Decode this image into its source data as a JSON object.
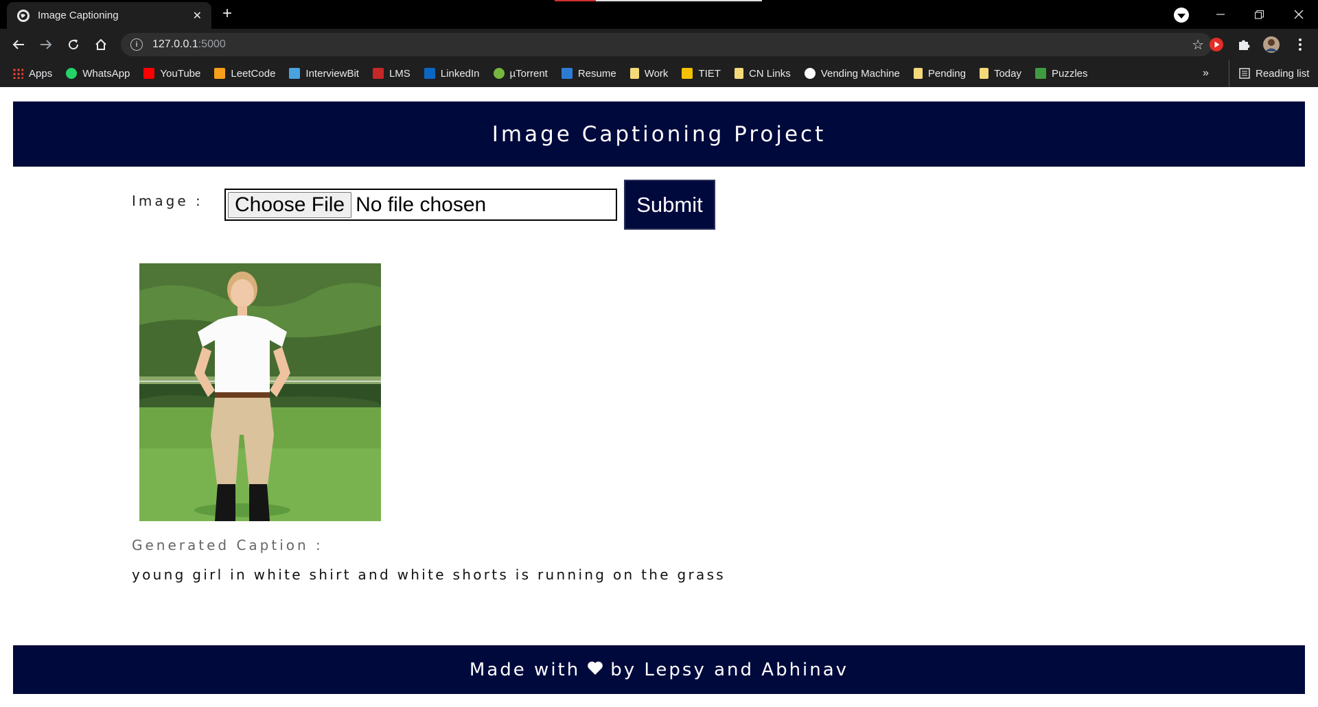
{
  "browser": {
    "tab_title": "Image Captioning",
    "tab_close": "✕",
    "new_tab": "+",
    "url_host": "127.0.0.1",
    "url_port": ":5000",
    "bookmarks": [
      {
        "label": "Apps",
        "icon": "apps-grid-icon",
        "color": "#ea4335"
      },
      {
        "label": "WhatsApp",
        "icon": "whatsapp-icon",
        "color": "#25d366"
      },
      {
        "label": "YouTube",
        "icon": "youtube-icon",
        "color": "#ff0000"
      },
      {
        "label": "LeetCode",
        "icon": "leetcode-icon",
        "color": "#f89f1b"
      },
      {
        "label": "InterviewBit",
        "icon": "interviewbit-icon",
        "color": "#4aa3df"
      },
      {
        "label": "LMS",
        "icon": "lms-icon",
        "color": "#c62828"
      },
      {
        "label": "LinkedIn",
        "icon": "linkedin-icon",
        "color": "#0a66c2"
      },
      {
        "label": "µTorrent",
        "icon": "utorrent-icon",
        "color": "#76b83f"
      },
      {
        "label": "Resume",
        "icon": "resume-icon",
        "color": "#2e7bd6"
      },
      {
        "label": "Work",
        "icon": "folder-icon",
        "color": "#f4d97a"
      },
      {
        "label": "TIET",
        "icon": "tiet-icon",
        "color": "#f2c200"
      },
      {
        "label": "CN Links",
        "icon": "folder-icon",
        "color": "#f4d97a"
      },
      {
        "label": "Vending Machine",
        "icon": "medium-icon",
        "color": "#ffffff"
      },
      {
        "label": "Pending",
        "icon": "folder-icon",
        "color": "#f4d97a"
      },
      {
        "label": "Today",
        "icon": "folder-icon",
        "color": "#f4d97a"
      },
      {
        "label": "Puzzles",
        "icon": "puzzles-icon",
        "color": "#3f9b3f"
      }
    ],
    "bookmarks_more": "»",
    "reading_list": "Reading list"
  },
  "page": {
    "header_title": "Image Captioning Project",
    "image_label": "Image :",
    "file_button": "Choose File",
    "file_status": "No file chosen",
    "submit_label": "Submit",
    "caption_label": "Generated Caption :",
    "caption_text": "young girl in white shirt and white shorts is running on the grass",
    "footer_before": "Made with",
    "footer_after": "by Lepsy and Abhinav"
  },
  "colors": {
    "brand_navy": "#00093c",
    "chrome_dark": "#1f1f1f"
  }
}
